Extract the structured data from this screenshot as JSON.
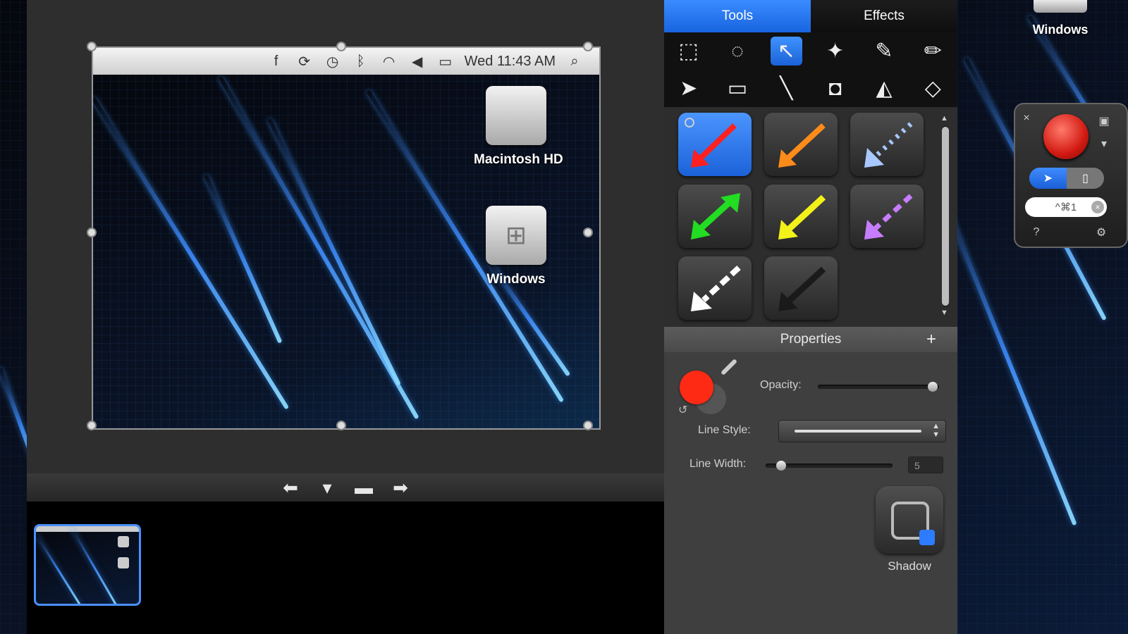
{
  "desktop": {
    "windows_label": "Windows"
  },
  "editor": {
    "menubar": {
      "icons": [
        "facebook-icon",
        "sync-icon",
        "time-machine-icon",
        "bluetooth-icon",
        "wifi-icon",
        "volume-icon",
        "battery-icon"
      ],
      "time": "Wed 11:43 AM"
    },
    "disks": [
      {
        "label": "Macintosh HD",
        "icon": "apple-logo"
      },
      {
        "label": "Windows",
        "icon": "windows-logo"
      }
    ]
  },
  "nav": {
    "prev_glyph": "⬅",
    "next_glyph": "➡"
  },
  "panel": {
    "tabs": [
      {
        "label": "Tools",
        "active": true
      },
      {
        "label": "Effects",
        "active": false
      }
    ],
    "tools": [
      {
        "name": "rectangle-select",
        "glyph": "⬚"
      },
      {
        "name": "lasso",
        "glyph": "◌"
      },
      {
        "name": "arrow",
        "glyph": "↖",
        "selected": true
      },
      {
        "name": "star-select",
        "glyph": "✦"
      },
      {
        "name": "pen",
        "glyph": "✎"
      },
      {
        "name": "pencil",
        "glyph": "✏"
      },
      {
        "name": "pointer",
        "glyph": "➤"
      },
      {
        "name": "rectangle",
        "glyph": "▭"
      },
      {
        "name": "line",
        "glyph": "╲"
      },
      {
        "name": "crop",
        "glyph": "◘"
      },
      {
        "name": "fill",
        "glyph": "◭"
      },
      {
        "name": "eraser",
        "glyph": "◇"
      }
    ],
    "arrow_styles": [
      {
        "color": "#ff2020",
        "style": "solid",
        "selected": true
      },
      {
        "color": "#ff8c1a",
        "style": "solid"
      },
      {
        "color": "#a8c8ff",
        "style": "dotted"
      },
      {
        "color": "#22dd22",
        "style": "double"
      },
      {
        "color": "#f2f21a",
        "style": "solid"
      },
      {
        "color": "#c77dff",
        "style": "dashed"
      },
      {
        "color": "#ffffff",
        "style": "dashed"
      },
      {
        "color": "#202020",
        "style": "solid"
      }
    ],
    "properties": {
      "header": "Properties",
      "plus": "+",
      "opacity_label": "Opacity:",
      "opacity_value": 0.95,
      "line_style_label": "Line Style:",
      "line_width_label": "Line Width:",
      "line_width_value": "5",
      "line_width_slider": 0.12,
      "shadow_label": "Shadow",
      "color": "#ff2a14"
    }
  },
  "widget": {
    "shortcut": "^⌘1",
    "help": "?",
    "gear": "⚙"
  }
}
